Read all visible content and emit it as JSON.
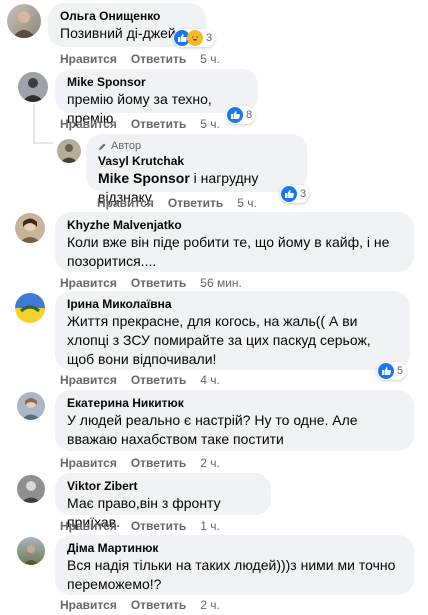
{
  "comments": [
    {
      "author": "Ольга Онищенко",
      "text": "Позивний ді-джей",
      "reactions": "3",
      "like": "Нравится",
      "reply": "Ответить",
      "time": "5 ч."
    },
    {
      "author": "Mike Sponsor",
      "text": "премію йому за техно, премію",
      "reactions": "8",
      "like": "Нравится",
      "reply": "Ответить",
      "time": "5 ч."
    },
    {
      "badge": "Автор",
      "author": "Vasyl Krutchak",
      "mention": "Mike Sponsor",
      "text": " і нагрудну відзнаку.",
      "reactions": "3",
      "like": "Нравится",
      "reply": "Ответить",
      "time": "5 ч."
    },
    {
      "author": "Khyzhe Malvenjatko",
      "text": "Коли вже він піде робити те, що йому в кайф, і не позоритися....",
      "like": "Нравится",
      "reply": "Ответить",
      "time": "56 мин."
    },
    {
      "author": "Ірина Миколаївна",
      "text": "Життя прекрасне, для когось, на жаль(( А ви хлопці з ЗСУ помирайте за цих паскуд серьож, щоб вони відпочивали!",
      "reactions": "5",
      "like": "Нравится",
      "reply": "Ответить",
      "time": "4 ч."
    },
    {
      "author": "Екатерина Никитюк",
      "text": "У людей реально є настрій? Ну то одне. Але вважаю нахабством таке постити",
      "like": "Нравится",
      "reply": "Ответить",
      "time": "2 ч."
    },
    {
      "author": "Viktor Zibert",
      "text": "Має право,він з фронту приїхав.",
      "like": "Нравится",
      "reply": "Ответить",
      "time": "1 ч."
    },
    {
      "author": "Діма Мартинюк",
      "text": "Вся надія тільки на таких людей)))з ними ми точно переможемо!?",
      "like": "Нравится",
      "reply": "Ответить",
      "time": "2 ч."
    }
  ],
  "colors": {
    "bubble": "#f0f2f5",
    "like_blue": "#1877f2",
    "haha_yellow": "#f7b928",
    "meta_gray": "#65676b"
  },
  "icons": {
    "like": "like-icon",
    "haha": "haha-icon",
    "author_badge": "pen-icon"
  }
}
